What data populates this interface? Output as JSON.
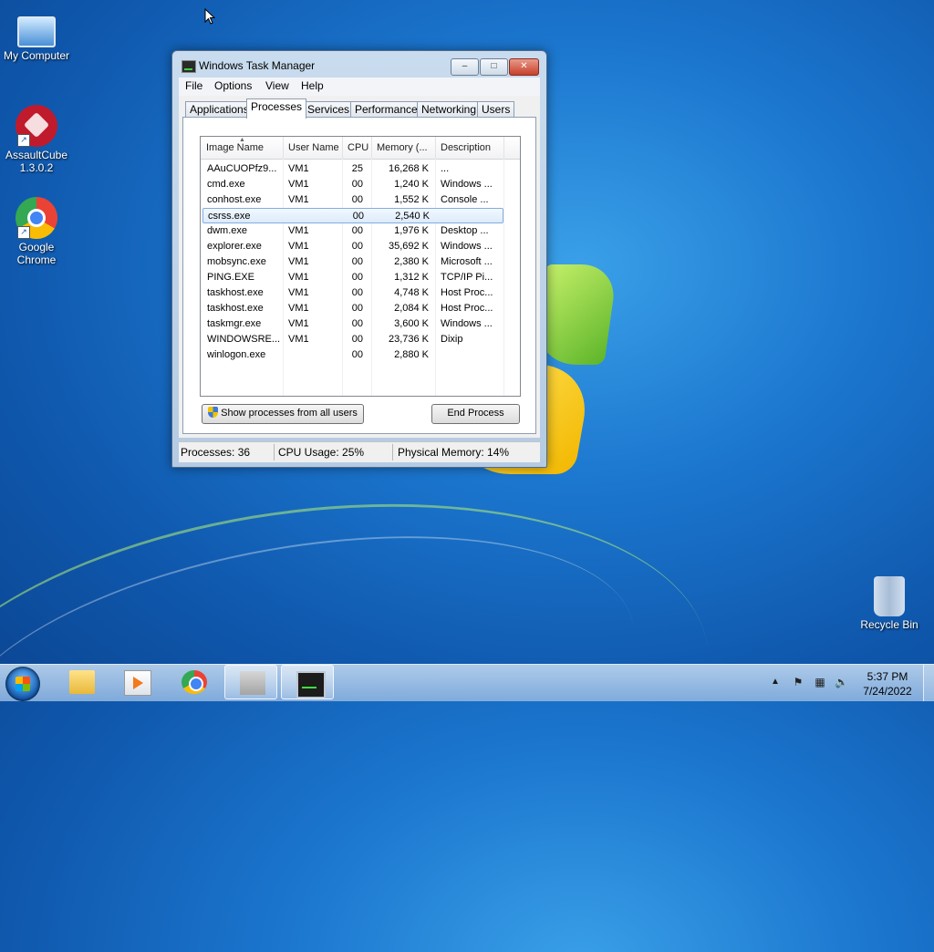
{
  "desktop": {
    "icons": [
      {
        "label": "My Computer"
      },
      {
        "label": "AssaultCube\n1.3.0.2",
        "line1": "AssaultCube",
        "line2": "1.3.0.2"
      },
      {
        "label": "Google Chrome",
        "line1": "Google",
        "line2": "Chrome"
      },
      {
        "label": "Recycle Bin"
      }
    ]
  },
  "window": {
    "title": "Windows Task Manager",
    "caption": {
      "minimize": "–",
      "maximize": "□",
      "close": "✕"
    },
    "menu": [
      "File",
      "Options",
      "View",
      "Help"
    ],
    "tabs": [
      "Applications",
      "Processes",
      "Services",
      "Performance",
      "Networking",
      "Users"
    ],
    "active_tab": "Processes",
    "columns": [
      "Image Name",
      "User Name",
      "CPU",
      "Memory (...",
      "Description"
    ],
    "rows": [
      {
        "name": "AAuCUOPfz9...",
        "user": "VM1",
        "cpu": "25",
        "mem": "16,268 K",
        "desc": "..."
      },
      {
        "name": "cmd.exe",
        "user": "VM1",
        "cpu": "00",
        "mem": "1,240 K",
        "desc": "Windows ..."
      },
      {
        "name": "conhost.exe",
        "user": "VM1",
        "cpu": "00",
        "mem": "1,552 K",
        "desc": "Console ..."
      },
      {
        "name": "csrss.exe",
        "user": "",
        "cpu": "00",
        "mem": "2,540 K",
        "desc": ""
      },
      {
        "name": "dwm.exe",
        "user": "VM1",
        "cpu": "00",
        "mem": "1,976 K",
        "desc": "Desktop ..."
      },
      {
        "name": "explorer.exe",
        "user": "VM1",
        "cpu": "00",
        "mem": "35,692 K",
        "desc": "Windows ..."
      },
      {
        "name": "mobsync.exe",
        "user": "VM1",
        "cpu": "00",
        "mem": "2,380 K",
        "desc": "Microsoft ..."
      },
      {
        "name": "PING.EXE",
        "user": "VM1",
        "cpu": "00",
        "mem": "1,312 K",
        "desc": "TCP/IP Pi..."
      },
      {
        "name": "taskhost.exe",
        "user": "VM1",
        "cpu": "00",
        "mem": "4,748 K",
        "desc": "Host Proc..."
      },
      {
        "name": "taskhost.exe",
        "user": "VM1",
        "cpu": "00",
        "mem": "2,084 K",
        "desc": "Host Proc..."
      },
      {
        "name": "taskmgr.exe",
        "user": "VM1",
        "cpu": "00",
        "mem": "3,600 K",
        "desc": "Windows ..."
      },
      {
        "name": "WINDOWSRE...",
        "user": "VM1",
        "cpu": "00",
        "mem": "23,736 K",
        "desc": "Dixip"
      },
      {
        "name": "winlogon.exe",
        "user": "",
        "cpu": "00",
        "mem": "2,880 K",
        "desc": ""
      }
    ],
    "selected_row": 3,
    "buttons": {
      "show_all": "Show processes from all users",
      "end_process": "End Process"
    },
    "status": {
      "processes": "Processes: 36",
      "cpu": "CPU Usage: 25%",
      "memory": "Physical Memory: 14%"
    }
  },
  "taskbar": {
    "clock_time": "5:37 PM",
    "clock_date": "7/24/2022",
    "tray_arrow": "▲",
    "apps": [
      "folder-icon",
      "media-player-icon",
      "chrome-icon",
      "blank-app-icon",
      "task-manager-icon"
    ],
    "active_app": "task-manager-icon"
  },
  "colors": {
    "selection": "#dcebfb",
    "close_button": "#c7402a",
    "accent_blue": "#1c77cf"
  }
}
